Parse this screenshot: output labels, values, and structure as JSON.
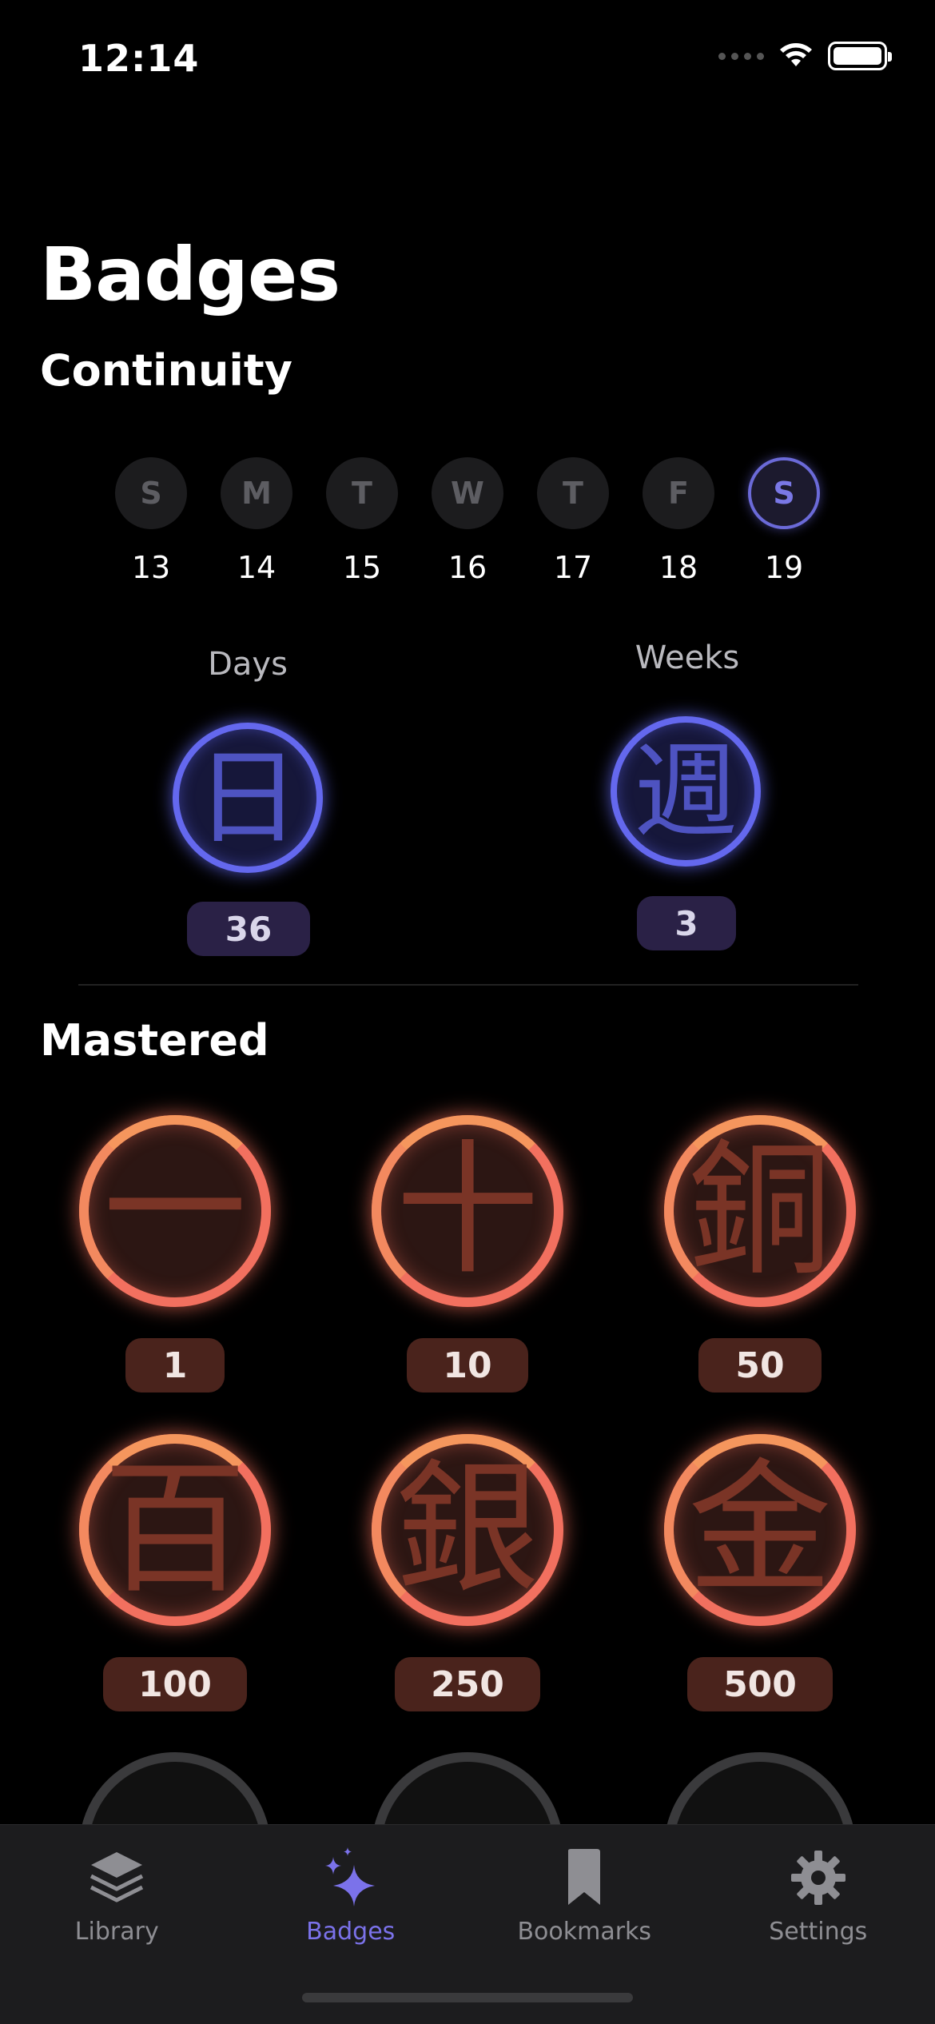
{
  "status_bar": {
    "time": "12:14"
  },
  "page_title": "Badges",
  "continuity": {
    "title": "Continuity",
    "week": [
      {
        "letter": "S",
        "date": "13",
        "active": false
      },
      {
        "letter": "M",
        "date": "14",
        "active": false
      },
      {
        "letter": "T",
        "date": "15",
        "active": false
      },
      {
        "letter": "W",
        "date": "16",
        "active": false
      },
      {
        "letter": "T",
        "date": "17",
        "active": false
      },
      {
        "letter": "F",
        "date": "18",
        "active": false
      },
      {
        "letter": "S",
        "date": "19",
        "active": true
      }
    ],
    "days": {
      "label": "Days",
      "kanji": "日",
      "count": "36"
    },
    "weeks": {
      "label": "Weeks",
      "kanji": "週",
      "count": "3"
    }
  },
  "mastered": {
    "title": "Mastered",
    "badges": [
      {
        "kanji": "一",
        "count": "1"
      },
      {
        "kanji": "十",
        "count": "10"
      },
      {
        "kanji": "銅",
        "count": "50"
      },
      {
        "kanji": "百",
        "count": "100"
      },
      {
        "kanji": "銀",
        "count": "250"
      },
      {
        "kanji": "金",
        "count": "500"
      }
    ]
  },
  "tabs": [
    {
      "label": "Library",
      "icon": "stack-icon",
      "active": false
    },
    {
      "label": "Badges",
      "icon": "sparkles-icon",
      "active": true
    },
    {
      "label": "Bookmarks",
      "icon": "bookmark-icon",
      "active": false
    },
    {
      "label": "Settings",
      "icon": "gear-icon",
      "active": false
    }
  ],
  "colors": {
    "accent": "#7b72ea",
    "continuity_badge": "#6468ee",
    "mastered_badge": "#f2705f",
    "background": "#000000"
  }
}
